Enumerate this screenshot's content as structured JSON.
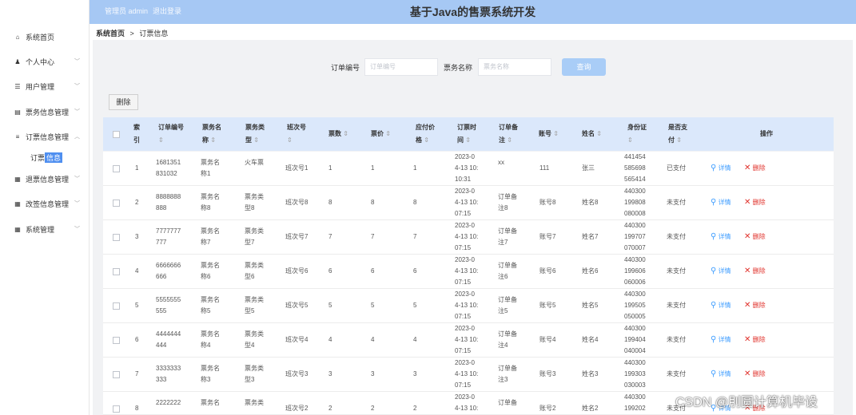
{
  "header": {
    "user_label": "管理员 admin",
    "logout": "退出登录",
    "title": "基于Java的售票系统开发"
  },
  "breadcrumb": {
    "home": "系统首页",
    "sep": ">",
    "current": "订票信息"
  },
  "sidebar": {
    "items": [
      {
        "label": "系统首页",
        "icon": "home-icon",
        "glyph": "⌂",
        "chevron": ""
      },
      {
        "label": "个人中心",
        "icon": "user-icon",
        "glyph": "♟",
        "chevron": "﹀"
      },
      {
        "label": "用户管理",
        "icon": "sliders-icon",
        "glyph": "☰",
        "chevron": "﹀"
      },
      {
        "label": "票务信息管理",
        "icon": "document-icon",
        "glyph": "▤",
        "chevron": "﹀"
      },
      {
        "label": "订票信息管理",
        "icon": "list-icon",
        "glyph": "≡",
        "chevron": "︿"
      },
      {
        "label": "退票信息管理",
        "icon": "grid-icon",
        "glyph": "▦",
        "chevron": "﹀"
      },
      {
        "label": "改签信息管理",
        "icon": "grid-icon",
        "glyph": "▦",
        "chevron": "﹀"
      },
      {
        "label": "系统管理",
        "icon": "grid-icon",
        "glyph": "▦",
        "chevron": "﹀"
      }
    ],
    "sub_item": {
      "label_a": "订票",
      "label_b": "信息"
    }
  },
  "search": {
    "order_no_label": "订单编号",
    "order_no_placeholder": "订单编号",
    "ticket_name_label": "票务名称",
    "ticket_name_placeholder": "票务名称",
    "query_button": "查询"
  },
  "toolbar": {
    "delete_button": "删除"
  },
  "table": {
    "headers": {
      "index_1": "索",
      "index_2": "引",
      "order_no": "订单编号",
      "name_1": "票务名",
      "name_2": "称",
      "type_1": "票务类",
      "type_2": "型",
      "train": "班次号",
      "count": "票数",
      "price": "票价",
      "pay_1": "应付价",
      "pay_2": "格",
      "time_1": "订票时",
      "time_2": "间",
      "remark_1": "订单备",
      "remark_2": "注",
      "account": "账号",
      "name": "姓名",
      "idcard": "身份证",
      "paid_1": "是否支",
      "paid_2": "付",
      "ops": "操作"
    },
    "sort_glyph": "⇕",
    "detail_label": "详情",
    "delete_label": "删除",
    "rows": [
      {
        "idx": "1",
        "order": [
          "1681351",
          "831032"
        ],
        "name": [
          "票务名",
          "称1"
        ],
        "type": [
          "火车票",
          ""
        ],
        "train": "班次号1",
        "count": "1",
        "price": "1",
        "pay": "1",
        "time": [
          "2023-0",
          "4-13 10:",
          "10:31"
        ],
        "remark": [
          "xx",
          ""
        ],
        "account": "111",
        "person": "张三",
        "idcard": [
          "441454",
          "585698",
          "565414"
        ],
        "paid": "已支付"
      },
      {
        "idx": "2",
        "order": [
          "8888888",
          "888"
        ],
        "name": [
          "票务名",
          "称8"
        ],
        "type": [
          "票务类",
          "型8"
        ],
        "train": "班次号8",
        "count": "8",
        "price": "8",
        "pay": "8",
        "time": [
          "2023-0",
          "4-13 10:",
          "07:15"
        ],
        "remark": [
          "订单备",
          "注8"
        ],
        "account": "账号8",
        "person": "姓名8",
        "idcard": [
          "440300",
          "199808",
          "080008"
        ],
        "paid": "未支付"
      },
      {
        "idx": "3",
        "order": [
          "7777777",
          "777"
        ],
        "name": [
          "票务名",
          "称7"
        ],
        "type": [
          "票务类",
          "型7"
        ],
        "train": "班次号7",
        "count": "7",
        "price": "7",
        "pay": "7",
        "time": [
          "2023-0",
          "4-13 10:",
          "07:15"
        ],
        "remark": [
          "订单备",
          "注7"
        ],
        "account": "账号7",
        "person": "姓名7",
        "idcard": [
          "440300",
          "199707",
          "070007"
        ],
        "paid": "未支付"
      },
      {
        "idx": "4",
        "order": [
          "6666666",
          "666"
        ],
        "name": [
          "票务名",
          "称6"
        ],
        "type": [
          "票务类",
          "型6"
        ],
        "train": "班次号6",
        "count": "6",
        "price": "6",
        "pay": "6",
        "time": [
          "2023-0",
          "4-13 10:",
          "07:15"
        ],
        "remark": [
          "订单备",
          "注6"
        ],
        "account": "账号6",
        "person": "姓名6",
        "idcard": [
          "440300",
          "199606",
          "060006"
        ],
        "paid": "未支付"
      },
      {
        "idx": "5",
        "order": [
          "5555555",
          "555"
        ],
        "name": [
          "票务名",
          "称5"
        ],
        "type": [
          "票务类",
          "型5"
        ],
        "train": "班次号5",
        "count": "5",
        "price": "5",
        "pay": "5",
        "time": [
          "2023-0",
          "4-13 10:",
          "07:15"
        ],
        "remark": [
          "订单备",
          "注5"
        ],
        "account": "账号5",
        "person": "姓名5",
        "idcard": [
          "440300",
          "199505",
          "050005"
        ],
        "paid": "未支付"
      },
      {
        "idx": "6",
        "order": [
          "4444444",
          "444"
        ],
        "name": [
          "票务名",
          "称4"
        ],
        "type": [
          "票务类",
          "型4"
        ],
        "train": "班次号4",
        "count": "4",
        "price": "4",
        "pay": "4",
        "time": [
          "2023-0",
          "4-13 10:",
          "07:15"
        ],
        "remark": [
          "订单备",
          "注4"
        ],
        "account": "账号4",
        "person": "姓名4",
        "idcard": [
          "440300",
          "199404",
          "040004"
        ],
        "paid": "未支付"
      },
      {
        "idx": "7",
        "order": [
          "3333333",
          "333"
        ],
        "name": [
          "票务名",
          "称3"
        ],
        "type": [
          "票务类",
          "型3"
        ],
        "train": "班次号3",
        "count": "3",
        "price": "3",
        "pay": "3",
        "time": [
          "2023-0",
          "4-13 10:",
          "07:15"
        ],
        "remark": [
          "订单备",
          "注3"
        ],
        "account": "账号3",
        "person": "姓名3",
        "idcard": [
          "440300",
          "199303",
          "030003"
        ],
        "paid": "未支付"
      },
      {
        "idx": "8",
        "order": [
          "2222222",
          ""
        ],
        "name": [
          "票务名",
          ""
        ],
        "type": [
          "票务类",
          ""
        ],
        "train": "班次号2",
        "count": "2",
        "price": "2",
        "pay": "2",
        "time": [
          "2023-0",
          "4-13 10:",
          ""
        ],
        "remark": [
          "订单备",
          ""
        ],
        "account": "账号2",
        "person": "姓名2",
        "idcard": [
          "440300",
          "199202",
          ""
        ],
        "paid": "未支付"
      }
    ]
  },
  "watermark": "CSDN @刖圆计算机毕设"
}
